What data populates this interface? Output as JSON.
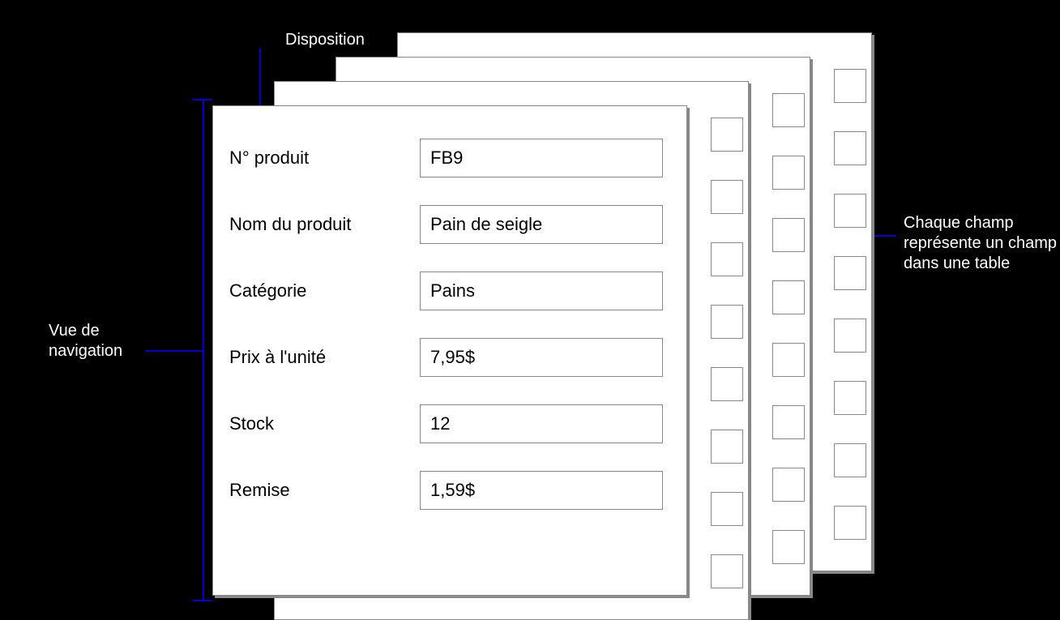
{
  "annotations": {
    "top": "Disposition",
    "left_line1": "Vue de",
    "left_line2": "navigation",
    "right_line1": "Chaque champ",
    "right_line2": "représente un champ",
    "right_line3": "dans une table"
  },
  "form": {
    "fields": [
      {
        "label": "N° produit",
        "value": "FB9"
      },
      {
        "label": "Nom du produit",
        "value": "Pain de seigle"
      },
      {
        "label": "Catégorie",
        "value": "Pains"
      },
      {
        "label": "Prix à l'unité",
        "value": "7,95$"
      },
      {
        "label": "Stock",
        "value": "12"
      },
      {
        "label": "Remise",
        "value": "1,59$"
      }
    ]
  }
}
